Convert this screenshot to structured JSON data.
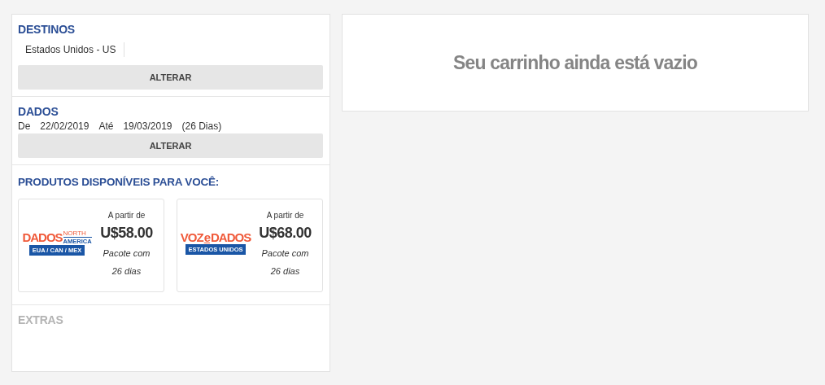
{
  "destinos": {
    "title": "DESTINOS",
    "items": [
      "Estados Unidos - US"
    ],
    "button": "ALTERAR"
  },
  "dados": {
    "title": "DADOS",
    "from_label": "De",
    "from": "22/02/2019",
    "to_label": "Até",
    "to": "19/03/2019",
    "duration": "(26 Dias)",
    "button": "ALTERAR"
  },
  "produtos": {
    "title": "PRODUTOS DISPONÍVEIS PARA VOCÊ:",
    "items": [
      {
        "kind": "north-america",
        "logo_main": "DADOS",
        "logo_side": [
          "NORTH",
          "AMERICA"
        ],
        "logo_band": "EUA / CAN / MEX",
        "from_label": "A partir de",
        "price": "U$58.00",
        "package": [
          "Pacote com",
          "26 dias"
        ]
      },
      {
        "kind": "voz-dados",
        "logo_main": [
          "VOZ",
          "e",
          "DADOS"
        ],
        "logo_band": "ESTADOS UNIDOS",
        "from_label": "A partir de",
        "price": "U$68.00",
        "package": [
          "Pacote com",
          "26 dias"
        ]
      }
    ]
  },
  "extras": {
    "title": "EXTRAS",
    "disabled": true
  },
  "cart": {
    "message": "Seu carrinho ainda está vazio"
  }
}
